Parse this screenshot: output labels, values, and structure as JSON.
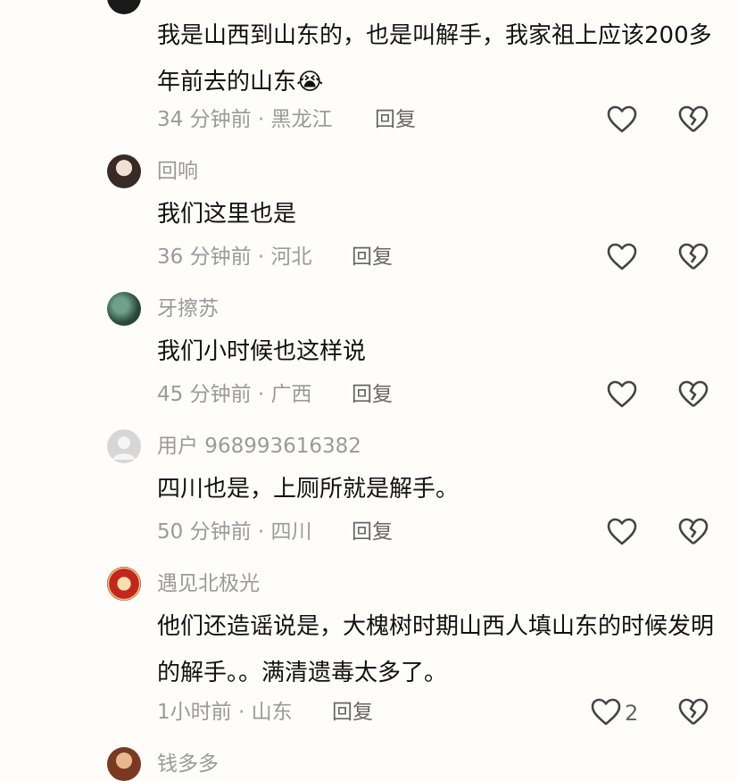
{
  "comments": [
    {
      "username": "",
      "text": "我是山西到山东的，也是叫解手，我家祖上应该200多年前去的山东",
      "emoji": "😭",
      "time": "34 分钟前",
      "region": "黑龙江",
      "reply_label": "回复",
      "likes": ""
    },
    {
      "username": "回响",
      "text": "我们这里也是",
      "time": "36 分钟前",
      "region": "河北",
      "reply_label": "回复",
      "likes": ""
    },
    {
      "username": "牙擦苏",
      "text": "我们小时候也这样说",
      "time": "45 分钟前",
      "region": "广西",
      "reply_label": "回复",
      "likes": ""
    },
    {
      "username": "用户 968993616382",
      "text": "四川也是，上厕所就是解手。",
      "time": "50 分钟前",
      "region": "四川",
      "reply_label": "回复",
      "likes": ""
    },
    {
      "username": "遇见北极光",
      "text": "他们还造谣说是，大槐树时期山西人填山东的时候发明的解手。。满清遗毒太多了。",
      "time": "1小时前",
      "region": "山东",
      "reply_label": "回复",
      "likes": "2"
    },
    {
      "username": "钱多多"
    }
  ],
  "separator": "·",
  "colors": {
    "background": "#fefdf9",
    "text": "#111111",
    "meta": "#9a9a9a"
  }
}
